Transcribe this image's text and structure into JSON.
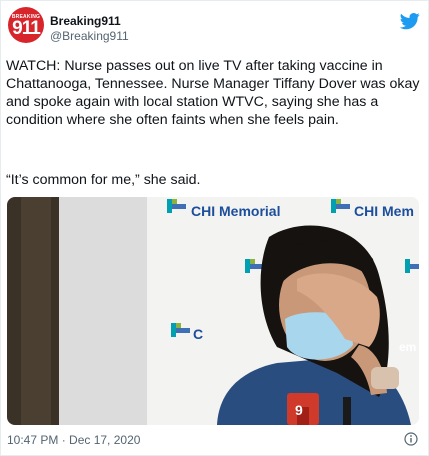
{
  "account": {
    "name": "Breaking911",
    "handle": "@Breaking911",
    "avatar_small_text": "BREAKING",
    "avatar_big_text": "911"
  },
  "tweet": {
    "text": "WATCH: Nurse passes out on live TV after taking vaccine in Chattanooga, Tennessee. Nurse Manager Tiffany Dover was okay and spoke again with local station WTVC, saying she has a condition where she often faints when she feels pain.",
    "quote": "“It’s common for me,” she said.",
    "timestamp": "10:47 PM · Dec 17, 2020"
  },
  "media": {
    "logo_text_1": "CHI Memorial",
    "logo_text_2": "CHI Mem",
    "logo_text_3": "C",
    "logo_text_4": "em",
    "mic_text": "9"
  },
  "colors": {
    "brand_blue": "#1d9bf0",
    "avatar_red": "#d8242b",
    "secondary_text": "#536471"
  },
  "icons": [
    "twitter-bird-icon",
    "info-icon"
  ]
}
